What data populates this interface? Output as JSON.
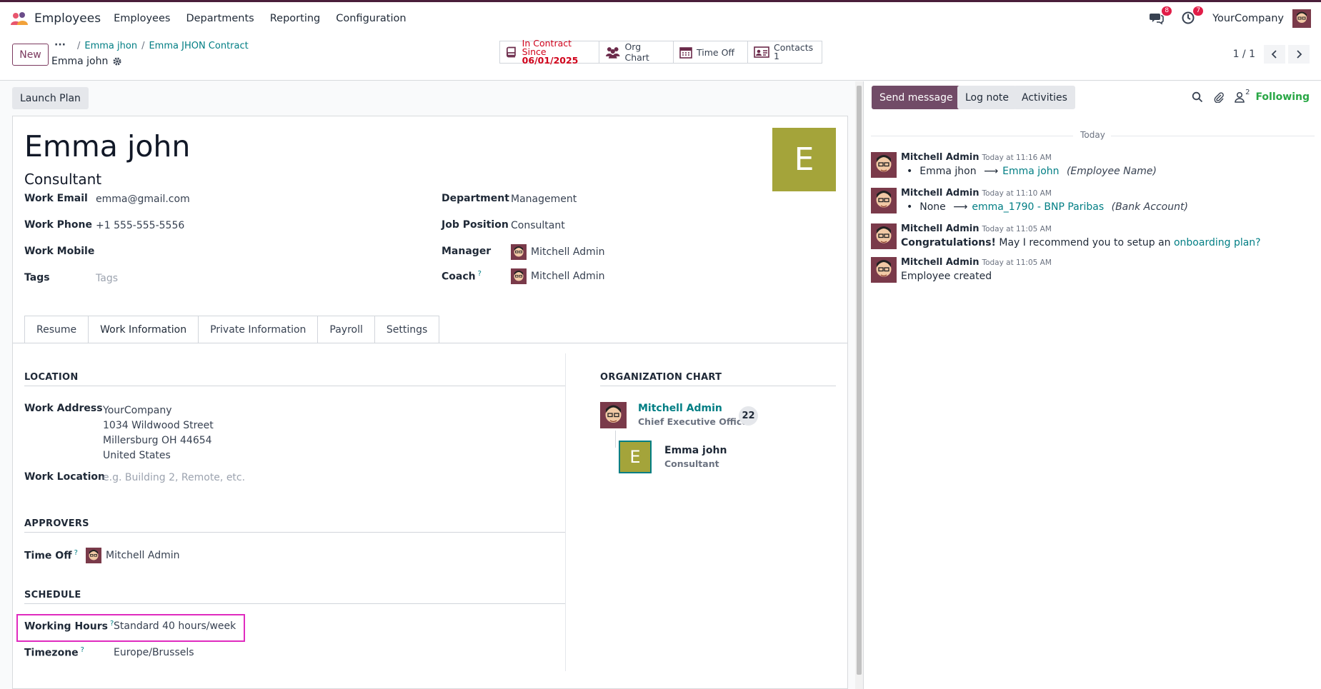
{
  "nav": {
    "app_name": "Employees",
    "menu": [
      "Employees",
      "Departments",
      "Reporting",
      "Configuration"
    ],
    "messages_badge": "8",
    "activities_badge": "7",
    "company": "YourCompany"
  },
  "control": {
    "new_label": "New",
    "breadcrumb": [
      "Emma jhon",
      "Emma JHON Contract"
    ],
    "current": "Emma john",
    "smart_buttons": {
      "contract_line1": "In Contract Since",
      "contract_line2": "06/01/2025",
      "org_chart": "Org Chart",
      "time_off": "Time Off",
      "contacts_label": "Contacts",
      "contacts_count": "1"
    },
    "pager": "1 / 1"
  },
  "form": {
    "launch_plan": "Launch Plan",
    "name": "Emma john",
    "job_title": "Consultant",
    "avatar_letter": "E",
    "fields": {
      "work_email_label": "Work Email",
      "work_email": "emma@gmail.com",
      "work_phone_label": "Work Phone",
      "work_phone": "+1 555-555-5556",
      "work_mobile_label": "Work Mobile",
      "tags_label": "Tags",
      "tags_placeholder": "Tags",
      "department_label": "Department",
      "department": "Management",
      "job_position_label": "Job Position",
      "job_position": "Consultant",
      "manager_label": "Manager",
      "manager": "Mitchell Admin",
      "coach_label": "Coach",
      "coach": "Mitchell Admin"
    },
    "tabs": [
      "Resume",
      "Work Information",
      "Private Information",
      "Payroll",
      "Settings"
    ],
    "location": {
      "title": "LOCATION",
      "work_address_label": "Work Address",
      "address_lines": [
        "YourCompany",
        "1034 Wildwood Street",
        "Millersburg OH 44654",
        "United States"
      ],
      "work_location_label": "Work Location",
      "work_location_placeholder": "e.g. Building 2, Remote, etc."
    },
    "approvers": {
      "title": "APPROVERS",
      "time_off_label": "Time Off",
      "time_off_user": "Mitchell Admin"
    },
    "schedule": {
      "title": "SCHEDULE",
      "working_hours_label": "Working Hours",
      "working_hours": "Standard 40 hours/week",
      "timezone_label": "Timezone",
      "timezone": "Europe/Brussels"
    },
    "org_chart": {
      "title": "ORGANIZATION CHART",
      "manager_name": "Mitchell Admin",
      "manager_title": "Chief Executive Officer",
      "manager_count": "22",
      "employee_letter": "E",
      "employee_name": "Emma john",
      "employee_title": "Consultant"
    }
  },
  "chatter": {
    "send_message": "Send message",
    "log_note": "Log note",
    "activities": "Activities",
    "followers_count": "2",
    "following": "Following",
    "today": "Today",
    "messages": [
      {
        "author": "Mitchell Admin",
        "time": "Today at 11:16 AM",
        "old": "Emma jhon",
        "new": "Emma john",
        "field": "(Employee Name)"
      },
      {
        "author": "Mitchell Admin",
        "time": "Today at 11:10 AM",
        "old": "None",
        "new": "emma_1790 - BNP Paribas",
        "field": "(Bank Account)"
      },
      {
        "author": "Mitchell Admin",
        "time": "Today at 11:05 AM",
        "bold": "Congratulations!",
        "text": "May I recommend you to setup an",
        "link": "onboarding plan?"
      },
      {
        "author": "Mitchell Admin",
        "time": "Today at 11:05 AM",
        "text": "Employee created"
      }
    ]
  },
  "colors": {
    "brand": "#714b67",
    "link": "#017e84",
    "highlight": "#e02bbf",
    "avatar_bg": "#a4a43a",
    "following": "#28a745",
    "contract_red": "#d0021b"
  }
}
